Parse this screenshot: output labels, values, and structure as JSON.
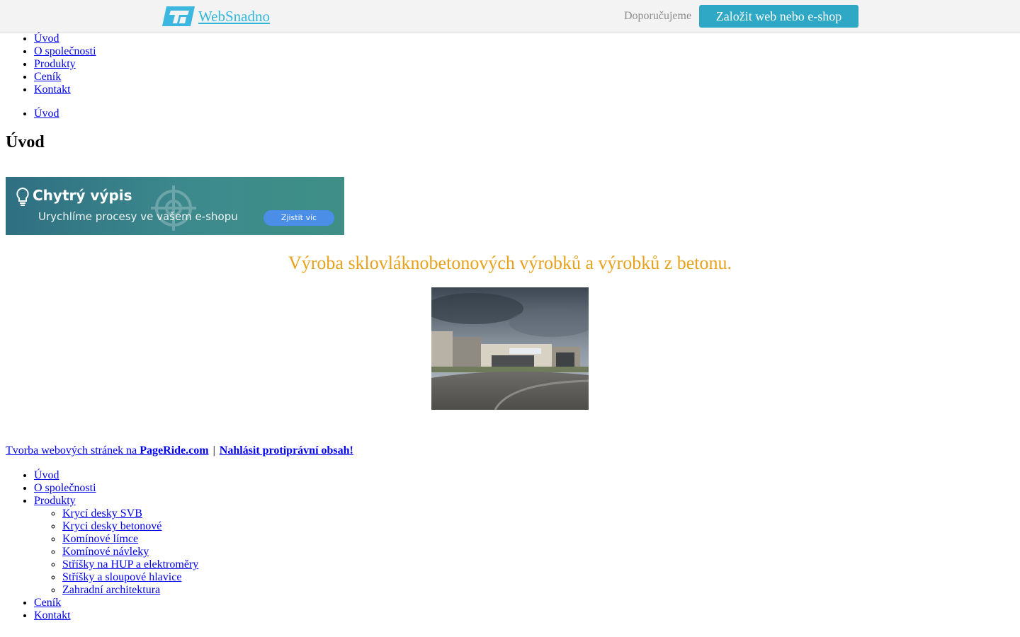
{
  "topbar": {
    "brand": "WebSnadno",
    "recommend": "Doporučujeme",
    "cta": "Založit web nebo e-shop",
    "colors": {
      "brand": "#34b6da",
      "cta_bg": "#2ea8c4"
    }
  },
  "menu": [
    "Úvod",
    "O společnosti",
    "Produkty",
    "Ceník",
    "Kontakt"
  ],
  "breadcrumb": [
    "Úvod"
  ],
  "page_title": "Úvod",
  "ad": {
    "title": "Chytrý výpis",
    "subtitle": "Urychlíme procesy ve vašem e-shopu",
    "button": "Zjistit víc"
  },
  "slogan": "Výroba sklovláknobetonových výrobků a výrobků z betonu.",
  "slogan_color": "#e8a11a",
  "footer": {
    "prefix": "Tvorba webových stránek na ",
    "pageride": "PageRide.com",
    "separator": "|",
    "report": "Nahlásit protiprávní obsah!"
  },
  "sitemap": {
    "items": [
      "Úvod",
      "O společnosti",
      "Produkty",
      "Ceník",
      "Kontakt"
    ],
    "products": [
      "Krycí desky SVB",
      "Kryci desky betonové",
      "Komínové límce",
      "Komínové návleky",
      "Stříšky na HUP a elektroměry",
      "Stříšky a sloupové hlavice",
      "Zahradní architektura"
    ]
  }
}
